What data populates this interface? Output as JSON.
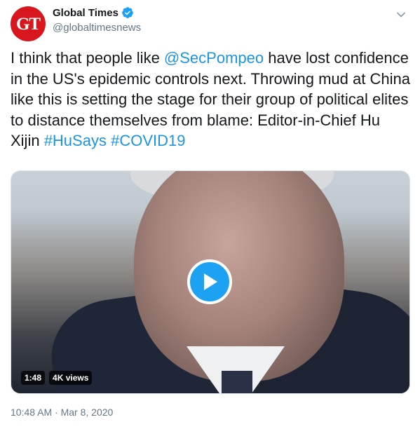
{
  "account": {
    "name": "Global Times",
    "handle": "@globaltimesnews",
    "avatar_text": "GT",
    "verified": true,
    "avatar_color": "#d7161e"
  },
  "tweet": {
    "text_before": "I think that people like ",
    "mention": "@SecPompeo",
    "text_after": " have lost confidence in the US's epidemic controls next. Throwing mud at China like this is setting the stage for their group of political elites to distance themselves from blame: Editor-in-Chief Hu Xijin ",
    "hashtag_1": "#HuSays",
    "hashtag_2": "#COVID19",
    "link_color": "#1b95e0"
  },
  "media": {
    "duration": "1:48",
    "views": "4K views",
    "play_icon": "play-icon"
  },
  "footer": {
    "timestamp": "10:48 AM · Mar 8, 2020"
  },
  "icons": {
    "verified": "verified-badge-icon",
    "menu": "chevron-down-icon"
  }
}
